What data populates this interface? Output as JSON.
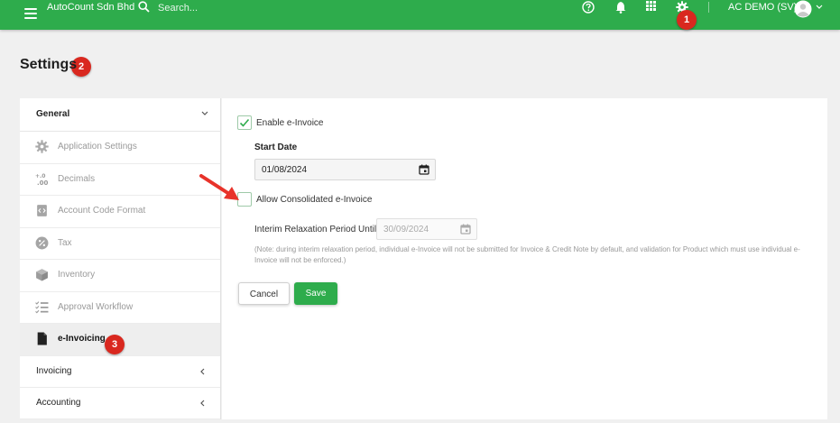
{
  "topbar": {
    "company": "AutoCount Sdn Bhd",
    "search_placeholder": "Search...",
    "icons": [
      "menu-icon",
      "search-icon",
      "help-icon",
      "bell-icon",
      "apps-grid-icon",
      "gear-icon",
      "user-avatar-icon",
      "chevron-down-icon"
    ],
    "user": "AC DEMO (SV)"
  },
  "badges": {
    "one": "1",
    "two": "2",
    "three": "3"
  },
  "page": {
    "title": "Settings"
  },
  "sidebar": {
    "section": "General",
    "items": [
      {
        "label": "Application Settings",
        "icon": "gear-icon"
      },
      {
        "label": "Decimals",
        "icon": "decimals-icon"
      },
      {
        "label": "Account Code Format",
        "icon": "code-format-icon"
      },
      {
        "label": "Tax",
        "icon": "percent-icon"
      },
      {
        "label": "Inventory",
        "icon": "box-icon"
      },
      {
        "label": "Approval Workflow",
        "icon": "checklist-icon"
      },
      {
        "label": "e-Invoicing",
        "icon": "document-icon"
      }
    ],
    "groups": [
      {
        "label": "Invoicing"
      },
      {
        "label": "Accounting"
      }
    ]
  },
  "form": {
    "enable_label": "Enable e-Invoice",
    "enable_checked": true,
    "start_date_title": "Start Date",
    "start_date_value": "01/08/2024",
    "consolidated_label": "Allow Consolidated e-Invoice",
    "consolidated_checked": false,
    "interim_label": "Interim Relaxation Period Until",
    "interim_value": "30/09/2024",
    "note": "(Note: during interim relaxation period, individual e-Invoice will not be submitted for Invoice & Credit Note by default, and validation for Product which must use individual e-Invoice will not be enforced.)",
    "cancel_label": "Cancel",
    "save_label": "Save"
  },
  "colors": {
    "brand": "#2eac4c",
    "badge": "#d9281f",
    "arrow": "#e8332a"
  }
}
